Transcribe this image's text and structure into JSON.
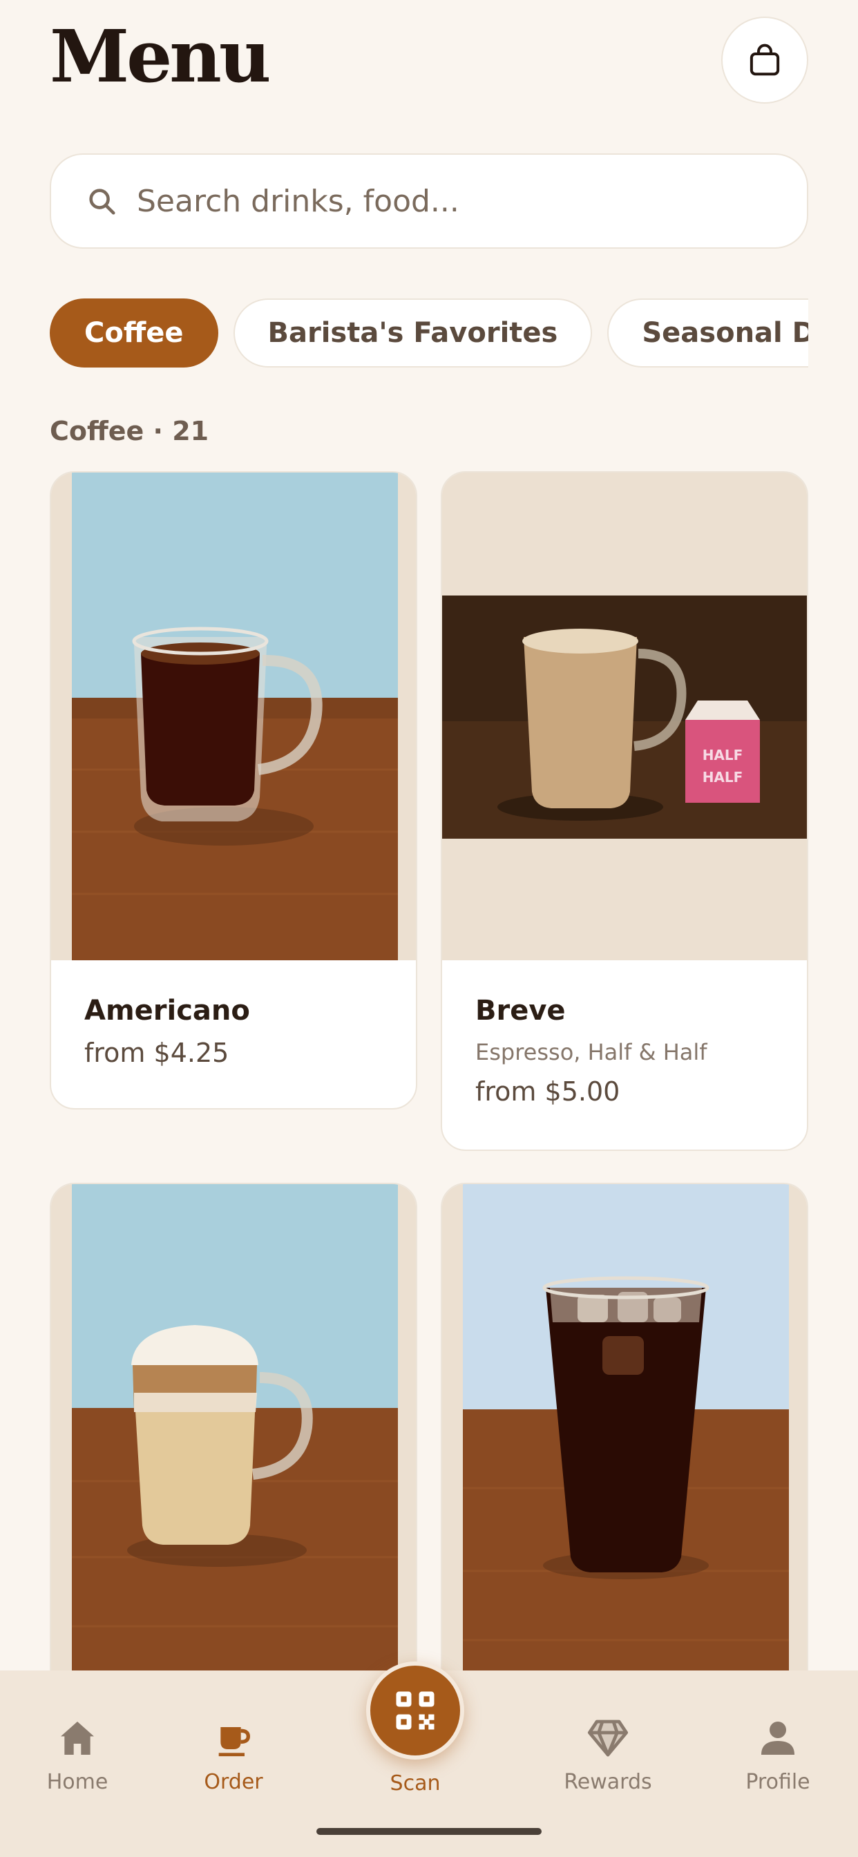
{
  "header": {
    "title": "Menu",
    "cart_icon": "shopping-bag-icon"
  },
  "search": {
    "placeholder": "Search drinks, food...",
    "icon": "search-icon"
  },
  "chips": [
    {
      "label": "Coffee",
      "active": true
    },
    {
      "label": "Barista's Favorites",
      "active": false
    },
    {
      "label": "Seasonal Drinks",
      "active": false
    }
  ],
  "section": {
    "title": "Coffee · 21"
  },
  "products": [
    {
      "name": "Americano",
      "description": "",
      "price": "from $4.25",
      "image": "black-coffee-mug"
    },
    {
      "name": "Breve",
      "description": "Espresso, Half & Half",
      "price": "from $5.00",
      "image": "breve-mug-with-milk-carton",
      "carton_text": "HALF & HALF"
    },
    {
      "name": "",
      "description": "",
      "price": "",
      "image": "layered-latte-mug"
    },
    {
      "name": "",
      "description": "",
      "price": "",
      "image": "iced-coffee-glass"
    }
  ],
  "nav": {
    "home": "Home",
    "order": "Order",
    "scan": "Scan",
    "rewards": "Rewards",
    "profile": "Profile",
    "active": "order"
  },
  "colors": {
    "accent": "#a65a1a",
    "background": "#faf5ef",
    "tabbar": "#f1e6d9",
    "text": "#2b1d14"
  }
}
